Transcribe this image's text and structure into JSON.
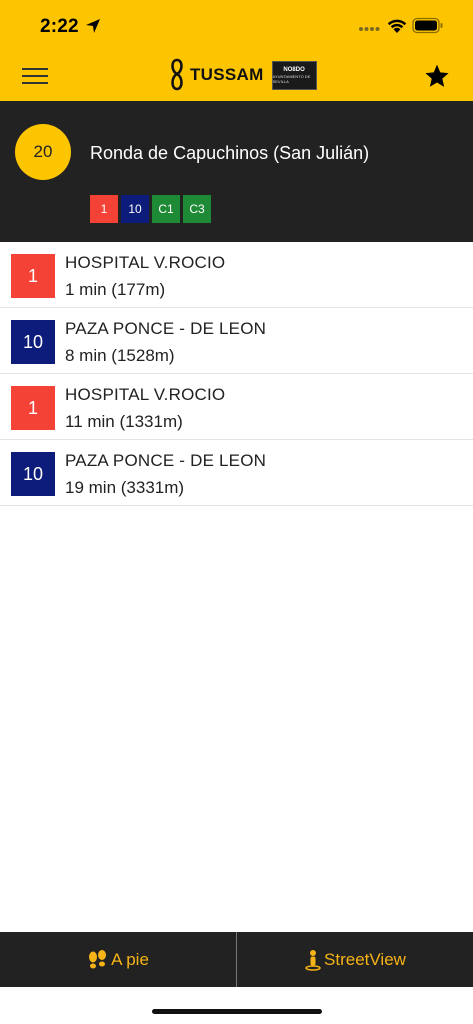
{
  "status_bar": {
    "time": "2:22"
  },
  "nav": {
    "logo_text": "TUSSAM",
    "logo_badge_line1": "NO8DO",
    "logo_badge_line2": "AYUNTAMIENTO DE SEVILLA"
  },
  "stop": {
    "number": "20",
    "name": "Ronda de Capuchinos (San Julián)",
    "lines": [
      {
        "label": "1",
        "color": "#F44336"
      },
      {
        "label": "10",
        "color": "#0D1B7A"
      },
      {
        "label": "C1",
        "color": "#1E8A35"
      },
      {
        "label": "C3",
        "color": "#1E8A35"
      }
    ]
  },
  "arrivals": [
    {
      "line": "1",
      "color": "#F44336",
      "destination": "HOSPITAL V.ROCIO",
      "eta": "1 min (177m)"
    },
    {
      "line": "10",
      "color": "#0D1B7A",
      "destination": "PAZA PONCE - DE LEON",
      "eta": "8 min (1528m)"
    },
    {
      "line": "1",
      "color": "#F44336",
      "destination": "HOSPITAL V.ROCIO",
      "eta": "11 min (1331m)"
    },
    {
      "line": "10",
      "color": "#0D1B7A",
      "destination": "PAZA PONCE - DE LEON",
      "eta": "19 min (3331m)"
    }
  ],
  "bottom_bar": {
    "walk_label": "A pie",
    "walk_icon": "footsteps-icon",
    "streetview_label": "StreetView",
    "streetview_icon": "pegman-icon"
  },
  "colors": {
    "brand_yellow": "#FDC500",
    "dark_bg": "#222222",
    "accent_orange": "#F5B316"
  }
}
